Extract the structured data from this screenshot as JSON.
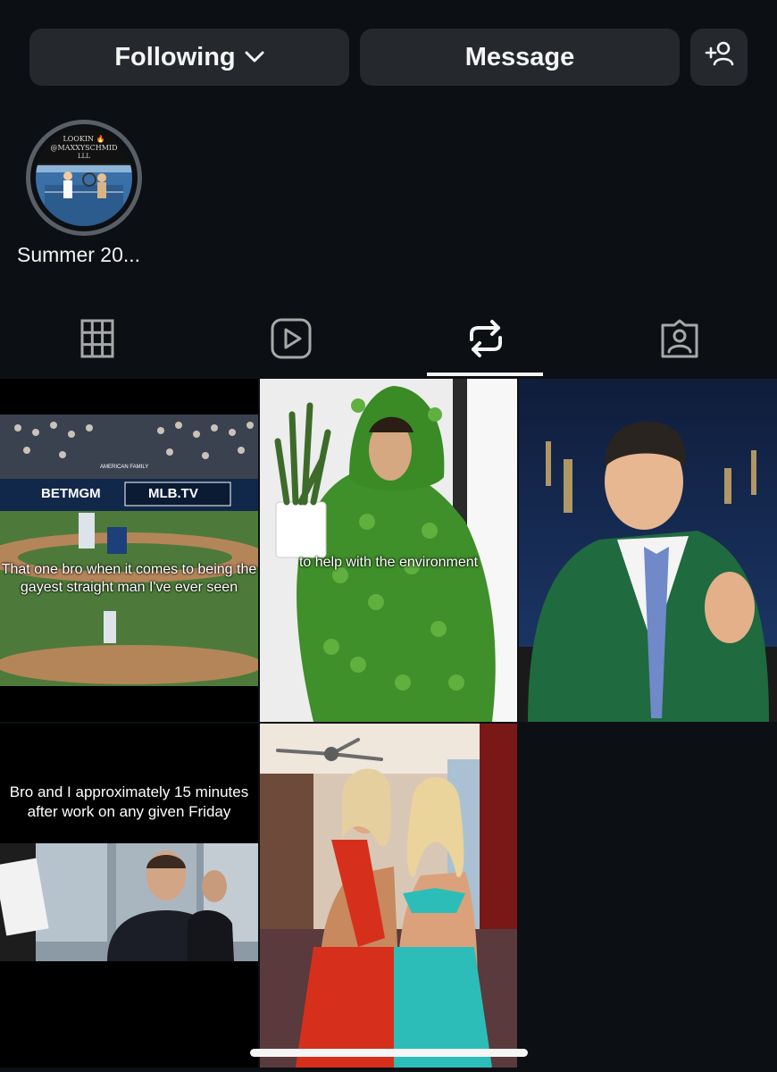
{
  "actions": {
    "following_label": "Following",
    "message_label": "Message"
  },
  "highlight": {
    "label": "Summer 20...",
    "cover_text_line1": "LOOKIN 🔥",
    "cover_text_line2": "@MAXXYSCHMID",
    "cover_text_line3": "LLL"
  },
  "tabs": [
    {
      "icon": "grid-icon",
      "active": false
    },
    {
      "icon": "reels-icon",
      "active": false
    },
    {
      "icon": "repost-icon",
      "active": true
    },
    {
      "icon": "tagged-icon",
      "active": false
    }
  ],
  "posts": [
    {
      "caption": "That one bro when it comes to being the gayest straight man I've ever seen",
      "overlay_texts": [
        "BETMGM",
        "MLB.TV",
        "AMERICAN FAMILY"
      ]
    },
    {
      "caption": "to help with the environment"
    },
    {
      "caption": ""
    },
    {
      "caption": "Bro and I approximately 15 minutes after work on any given Friday"
    },
    {
      "caption": ""
    }
  ],
  "colors": {
    "background": "#0c1014",
    "button": "#25292e",
    "text": "#f5f5f5"
  }
}
